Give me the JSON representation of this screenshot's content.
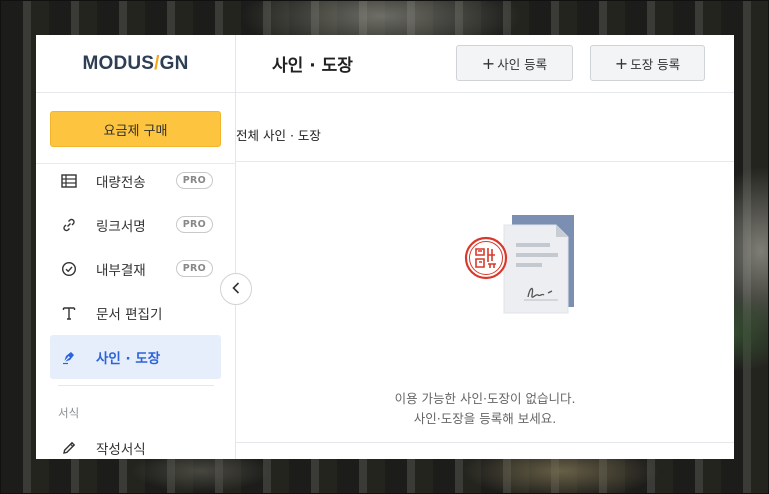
{
  "logo": {
    "part1": "MODUS",
    "slash": "/",
    "part2": "GN"
  },
  "sidebar": {
    "plan_button": "요금제 구매",
    "items": [
      {
        "label": "대량전송",
        "icon": "table-icon",
        "badge": "PRO"
      },
      {
        "label": "링크서명",
        "icon": "link-icon",
        "badge": "PRO"
      },
      {
        "label": "내부결재",
        "icon": "check-circle-icon",
        "badge": "PRO"
      },
      {
        "label": "문서 편집기",
        "icon": "text-icon"
      },
      {
        "label": "사인 · 도장",
        "icon": "pen-nib-icon",
        "active": true
      }
    ],
    "section_label": "서식",
    "section_items": [
      {
        "label": "작성서식",
        "icon": "pencil-icon"
      }
    ]
  },
  "header": {
    "title": "사인 · 도장",
    "add_sign_button": "사인 등록",
    "add_stamp_button": "도장 등록",
    "plus": "+"
  },
  "content": {
    "list_title": "전체 사인 · 도장",
    "empty_line1": "이용 가능한 사인·도장이 없습니다.",
    "empty_line2": "사인·도장을 등록해 보세요."
  },
  "colors": {
    "accent_yellow": "#fcc43f",
    "active_bg": "#e6eefc",
    "active_text": "#2d63d8",
    "stamp_red": "#d9392b",
    "doc_blue": "#7b8fb3"
  }
}
